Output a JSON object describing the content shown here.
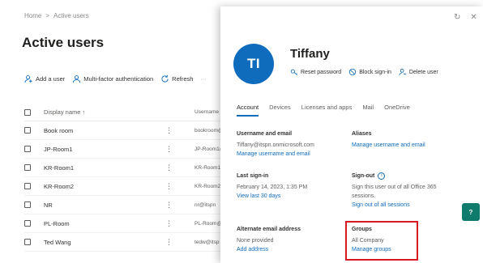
{
  "breadcrumb": [
    "Home",
    ">",
    "Active users"
  ],
  "page_title": "Active users",
  "toolbar": {
    "add_user": "Add a user",
    "mfa": "Multi-factor authentication",
    "refresh": "Refresh",
    "more": "···"
  },
  "grid": {
    "col_display": "Display name ↑",
    "col_username": "Username",
    "rows": [
      {
        "name": "Book room",
        "user": "bookroom@"
      },
      {
        "name": "JP-Room1",
        "user": "JP-Room1@"
      },
      {
        "name": "KR-Room1",
        "user": "KR-Room1@"
      },
      {
        "name": "KR-Room2",
        "user": "KR-Room2@"
      },
      {
        "name": "NR",
        "user": "nr@itspn"
      },
      {
        "name": "PL-Room",
        "user": "PL-Room@"
      },
      {
        "name": "Ted Wang",
        "user": "tedw@itsp"
      }
    ]
  },
  "panel": {
    "avatar_initials": "TI",
    "user_name": "Tiffany",
    "actions": {
      "reset_password": "Reset password",
      "block_sign_in": "Block sign-in",
      "delete_user": "Delete user"
    },
    "tabs": [
      "Account",
      "Devices",
      "Licenses and apps",
      "Mail",
      "OneDrive"
    ],
    "active_tab": "Account",
    "sections": {
      "username": {
        "heading": "Username and email",
        "value": "Tiffany@itspn.onmicrosoft.com",
        "link": "Manage username and email"
      },
      "aliases": {
        "heading": "Aliases",
        "link": "Manage username and email"
      },
      "last_signin": {
        "heading": "Last sign-in",
        "value": "February 14, 2023, 1:35 PM",
        "link": "View last 30 days"
      },
      "signout": {
        "heading": "Sign-out",
        "value": "Sign this user out of all Office 365 sessions.",
        "link": "Sign out of all sessions"
      },
      "alt_email": {
        "heading": "Alternate email address",
        "value": "None provided",
        "link": "Add address"
      },
      "groups": {
        "heading": "Groups",
        "value": "All Company",
        "link": "Manage groups"
      }
    }
  },
  "fab_label": "?",
  "colors": {
    "accent": "#0f6cbd",
    "highlight": "#d71920",
    "fab": "#0f7b6c"
  }
}
